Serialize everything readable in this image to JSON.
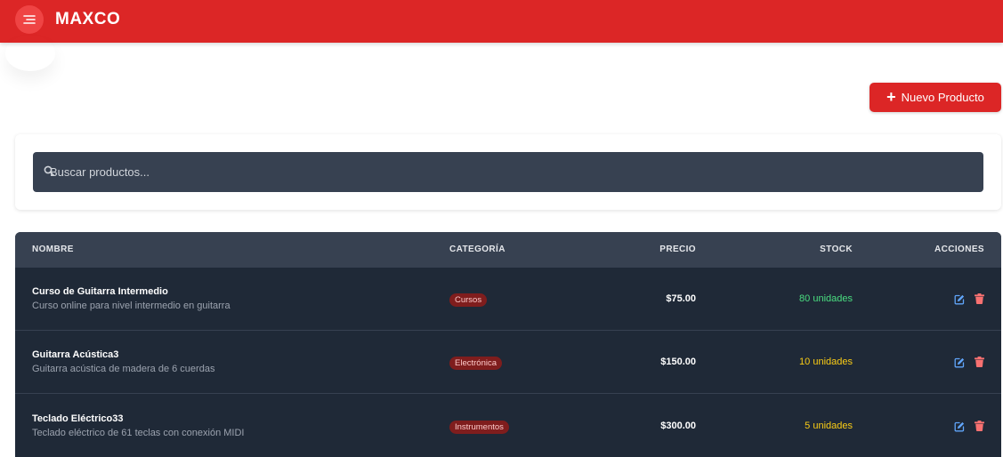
{
  "header": {
    "brand": "MAXCO",
    "menu_icon": "menu-icon"
  },
  "toolbar": {
    "new_product_label": "Nuevo Producto"
  },
  "search": {
    "placeholder": "Buscar productos...",
    "value": ""
  },
  "table": {
    "columns": [
      "NOMBRE",
      "CATEGORÍA",
      "PRECIO",
      "STOCK",
      "ACCIONES"
    ],
    "rows": [
      {
        "name": "Curso de Guitarra Intermedio",
        "description": "Curso online para nivel intermedio en guitarra",
        "category": "Cursos",
        "price": "$75.00",
        "stock": "80 unidades",
        "stock_color": "#4ade80"
      },
      {
        "name": "Guitarra Acústica3",
        "description": "Guitarra acústica de madera de 6 cuerdas",
        "category": "Electrónica",
        "price": "$150.00",
        "stock": "10 unidades",
        "stock_color": "#facc15"
      },
      {
        "name": "Teclado Eléctrico33",
        "description": "Teclado eléctrico de 61 teclas con conexión MIDI",
        "category": "Instrumentos",
        "price": "$300.00",
        "stock": "5 unidades",
        "stock_color": "#facc15"
      }
    ]
  },
  "colors": {
    "brand_red": "#dc2626",
    "table_bg": "#1f2937",
    "header_bg": "#374151",
    "edit_blue": "#60a5fa",
    "delete_red": "#f87171"
  }
}
